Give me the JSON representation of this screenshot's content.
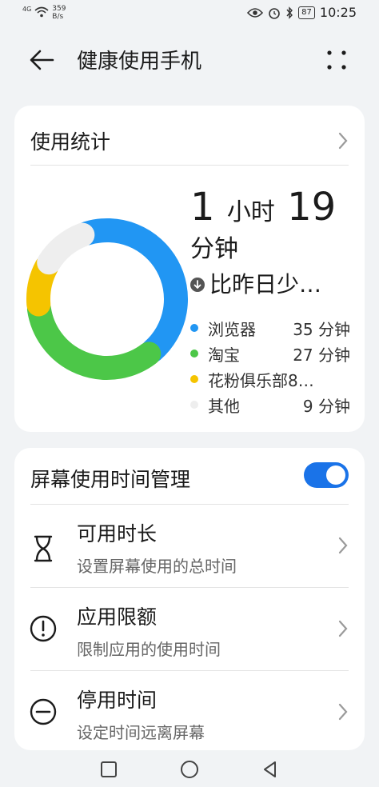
{
  "status_bar": {
    "signal": "4G",
    "speed_value": "359",
    "speed_unit": "B/s",
    "battery": "87",
    "time": "10:25"
  },
  "header": {
    "title": "健康使用手机"
  },
  "usage": {
    "title": "使用统计",
    "total_hours": "1",
    "hours_unit": "小时",
    "total_minutes": "19",
    "minutes_unit": "分钟",
    "delta_text": "比昨日少…",
    "legend": [
      {
        "name": "浏览器",
        "value": "35 分钟",
        "color": "#2196f3",
        "minutes": 35
      },
      {
        "name": "淘宝",
        "value": "27 分钟",
        "color": "#4cc748",
        "minutes": 27
      },
      {
        "name": "花粉俱乐部8…",
        "value": "",
        "color": "#f5c400",
        "minutes": 8
      },
      {
        "name": "其他",
        "value": "9 分钟",
        "color": "#eeeeee",
        "minutes": 9
      }
    ]
  },
  "management": {
    "title": "屏幕使用时间管理",
    "toggle_on": true,
    "accent": "#1a73e8",
    "items": [
      {
        "title": "可用时长",
        "subtitle": "设置屏幕使用的总时间",
        "icon": "hourglass-icon"
      },
      {
        "title": "应用限额",
        "subtitle": "限制应用的使用时间",
        "icon": "alert-circle-icon"
      },
      {
        "title": "停用时间",
        "subtitle": "设定时间远离屏幕",
        "icon": "minus-circle-icon"
      }
    ]
  }
}
